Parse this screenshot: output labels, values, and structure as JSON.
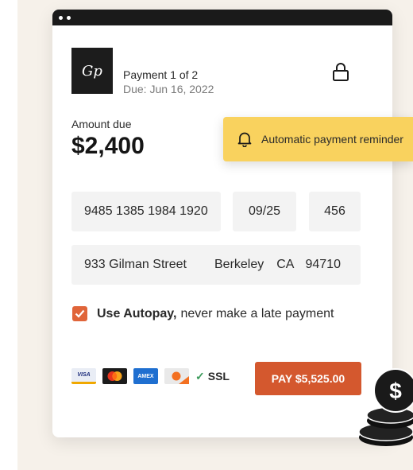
{
  "payment": {
    "logo_text": "Gp",
    "title": "Payment 1 of 2",
    "due": "Due: Jun 16, 2022",
    "amount_label": "Amount due",
    "amount": "$2,400"
  },
  "form": {
    "card_number": "9485 1385 1984 1920",
    "expiry": "09/25",
    "cvv": "456",
    "address": {
      "street": "933 Gilman Street",
      "city": "Berkeley",
      "state": "CA",
      "zip": "94710"
    },
    "autopay_bold": "Use Autopay,",
    "autopay_rest": "never make a late payment",
    "autopay_checked": true
  },
  "footer": {
    "cards": [
      "VISA",
      "mastercard",
      "AMEX",
      "discover"
    ],
    "ssl": "SSL",
    "pay_button": "PAY $5,525.00"
  },
  "reminder": {
    "text": "Automatic payment reminder"
  },
  "coin_symbol": "$",
  "colors": {
    "accent": "#d4582e",
    "reminder": "#f9d25e",
    "checkbox": "#e0653a",
    "titlebar": "#1a1a1a"
  }
}
